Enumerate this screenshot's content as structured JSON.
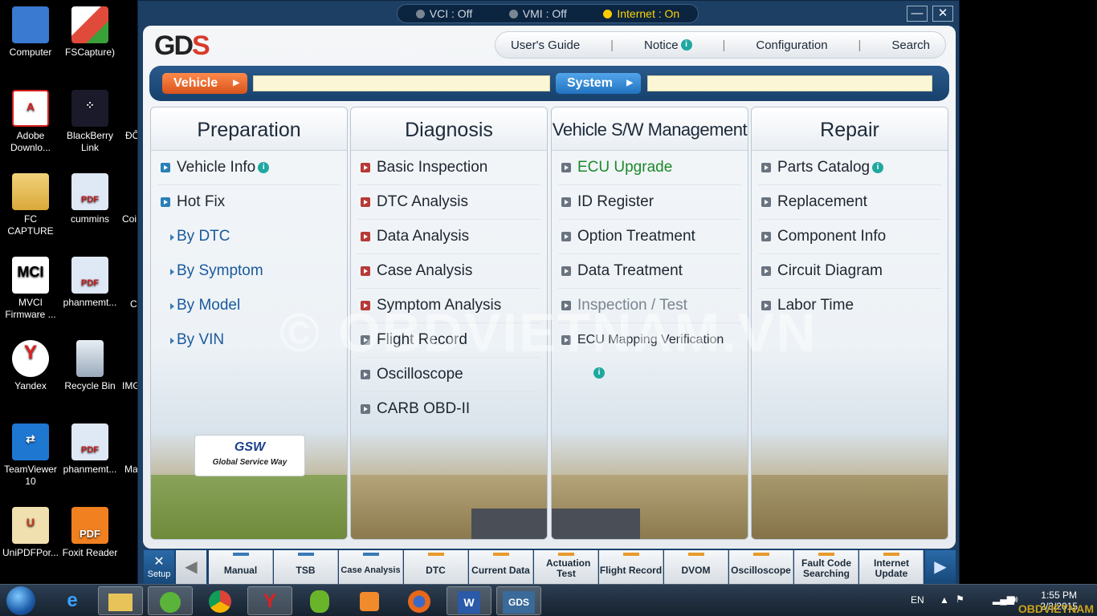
{
  "desktop": {
    "icons": [
      {
        "label": "Computer",
        "icon": "computer-icon",
        "color": "#3a7ad0"
      },
      {
        "label": "FSCapture)",
        "icon": "fscapture-icon",
        "color": "#e04a3a"
      },
      {
        "label": "Adobe Downlo...",
        "icon": "adobe-icon",
        "color": "#d81f1f"
      },
      {
        "label": "BlackBerry Link",
        "icon": "blackberry-icon",
        "color": "#222244"
      },
      {
        "label": "FC CAPTURE",
        "icon": "folder-icon",
        "color": "#e8c35a"
      },
      {
        "label": "cummins",
        "icon": "pdf-icon",
        "color": "#c8d8f0"
      },
      {
        "label": "MVCI Firmware ...",
        "icon": "mvci-icon",
        "color": "#ffffff"
      },
      {
        "label": "phanmemt...",
        "icon": "pdf-icon",
        "color": "#c8d8f0"
      },
      {
        "label": "Yandex",
        "icon": "yandex-icon",
        "color": "#ffffff"
      },
      {
        "label": "Recycle Bin",
        "icon": "recycle-bin-icon",
        "color": "#b8c8d8"
      },
      {
        "label": "TeamViewer 10",
        "icon": "teamviewer-icon",
        "color": "#1e78d2"
      },
      {
        "label": "phanmemt...",
        "icon": "pdf-icon",
        "color": "#c8d8f0"
      },
      {
        "label": "UniPDFPor...",
        "icon": "unipdf-icon",
        "color": "#c83a1a"
      },
      {
        "label": "Foxit Reader",
        "icon": "foxit-icon",
        "color": "#f08020"
      }
    ],
    "partial_labels": [
      "ĐÔ",
      "Coi",
      "C C",
      "IMG",
      "Ma"
    ]
  },
  "window": {
    "status": {
      "vci": "VCI : Off",
      "vmi": "VMI : Off",
      "internet": "Internet : On"
    },
    "minimize": "—",
    "close": "✕",
    "logo_left": "GD",
    "logo_right": "S",
    "top_menu": {
      "users_guide": "User's Guide",
      "notice": "Notice",
      "configuration": "Configuration",
      "search": "Search",
      "separator": "|"
    },
    "vehicle_label": "Vehicle",
    "vehicle_value": "",
    "system_label": "System",
    "system_value": ""
  },
  "columns": {
    "preparation": {
      "title": "Preparation",
      "items": [
        "Vehicle Info",
        "Hot Fix"
      ],
      "sub_items": [
        "By DTC",
        "By Symptom",
        "By Model",
        "By VIN"
      ],
      "gsw_logo": "GSW",
      "gsw_text": "Global Service Way"
    },
    "diagnosis": {
      "title": "Diagnosis",
      "items": [
        "Basic Inspection",
        "DTC Analysis",
        "Data Analysis",
        "Case Analysis",
        "Symptom Analysis",
        "Flight Record",
        "Oscilloscope",
        "CARB OBD-II"
      ]
    },
    "vehicle_sw": {
      "title": "Vehicle S/W Management",
      "items": [
        "ECU Upgrade",
        "ID Register",
        "Option Treatment",
        "Data Treatment",
        "Inspection / Test",
        "ECU Mapping Verification"
      ]
    },
    "repair": {
      "title": "Repair",
      "items": [
        "Parts Catalog",
        "Replacement",
        "Component Info",
        "Circuit Diagram",
        "Labor Time"
      ]
    }
  },
  "watermark": "© OBDVIETNAM.VN",
  "toolbar": {
    "setup": "Setup",
    "buttons": [
      "Manual",
      "TSB",
      "Case Analysis",
      "DTC",
      "Current Data",
      "Actuation Test",
      "Flight Record",
      "DVOM",
      "Oscilloscope",
      "Fault Code Searching",
      "Internet Update"
    ]
  },
  "taskbar": {
    "apps": [
      "internet-explorer-icon",
      "file-explorer-icon",
      "green-app-icon",
      "chrome-icon",
      "yandex-icon",
      "parrot-icon",
      "media-player-icon",
      "firefox-icon",
      "word-icon",
      "gds-icon"
    ],
    "gds_label": "GDS",
    "word_label": "W",
    "lang": "EN",
    "time": "1:55 PM",
    "date": "2/3/2015",
    "watermark": "OBDVIETNAM"
  }
}
